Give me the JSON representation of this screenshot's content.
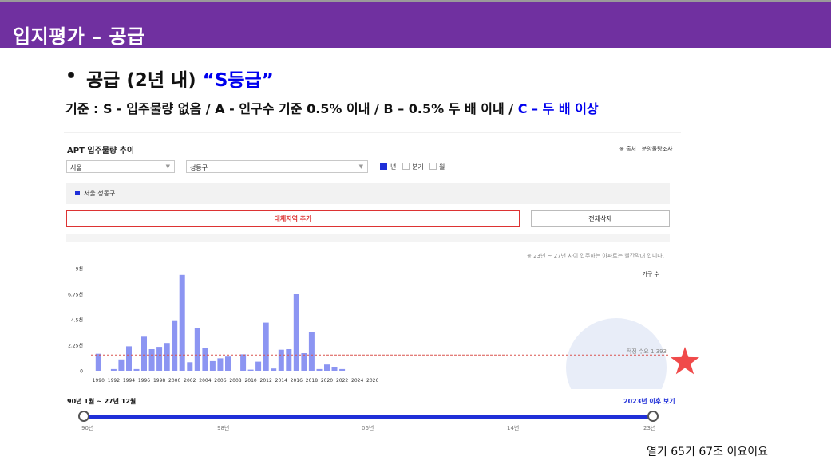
{
  "slide": {
    "title": "입지평가 – 공급",
    "bullet": "•",
    "headline_prefix": "공급 (2년 내) ",
    "headline_grade": "“S등급”",
    "criteria_main": "기준 : S - 입주물량 없음 / A - 인구수 기준 0.5% 이내 / B – 0.5% 두 배 이내 / ",
    "criteria_blue": "C – 두 배 이상",
    "footer": "열기 65기 67조 이요이요"
  },
  "panel": {
    "title": "APT 입주물량 추이",
    "source": "※ 출처 : 분양물량조사",
    "region_select": "서울",
    "district_select": "성동구",
    "period_options": [
      "년",
      "분기",
      "월"
    ],
    "period_selected": "년",
    "legend_item": "서울 성동구",
    "add_region_button": "대체지역 추가",
    "delete_all_button": "전체삭제",
    "note": "※ 23년 ~ 27년 사이 입주하는 아파트는 빨간막대 입니다.",
    "range_label": "90년 1월 ~ 27년 12월",
    "after_link": "2023년 이후 보기",
    "slider_ticks": [
      "90년",
      "98년",
      "06년",
      "14년",
      "23년"
    ]
  },
  "colors": {
    "header": "#7030a0",
    "bar": "#8c95f2",
    "accent": "#1f2fd8",
    "demand_line": "#d9534f",
    "star": "#f04a4a"
  },
  "chart_data": {
    "type": "bar",
    "unit_label": "가구 수",
    "categories": [
      "1990",
      "1991",
      "1992",
      "1993",
      "1994",
      "1995",
      "1996",
      "1997",
      "1998",
      "1999",
      "2000",
      "2001",
      "2002",
      "2003",
      "2004",
      "2005",
      "2006",
      "2007",
      "2008",
      "2009",
      "2010",
      "2011",
      "2012",
      "2013",
      "2014",
      "2015",
      "2016",
      "2017",
      "2018",
      "2019",
      "2020",
      "2021",
      "2022",
      "2023",
      "2024",
      "2025",
      "2026",
      "2027"
    ],
    "values": [
      1500,
      0,
      150,
      1000,
      2150,
      150,
      3000,
      1900,
      2100,
      2450,
      4450,
      8450,
      750,
      3750,
      2000,
      850,
      1100,
      1250,
      0,
      1450,
      100,
      800,
      4250,
      200,
      1850,
      1900,
      6750,
      1550,
      3400,
      150,
      550,
      350,
      150,
      0,
      0,
      0,
      0,
      0
    ],
    "x_tick_labels": [
      "1990",
      "1992",
      "1994",
      "1996",
      "1998",
      "2000",
      "2002",
      "2004",
      "2006",
      "2008",
      "2010",
      "2012",
      "2014",
      "2016",
      "2018",
      "2020",
      "2022",
      "2024",
      "2026"
    ],
    "y_tick_labels": [
      "0",
      "2.25천",
      "4.5천",
      "6.75천",
      "9천"
    ],
    "ylim": [
      0,
      9000
    ],
    "reference_line": {
      "label": "적정 수요 1,393",
      "value": 1393
    },
    "grid": false
  }
}
